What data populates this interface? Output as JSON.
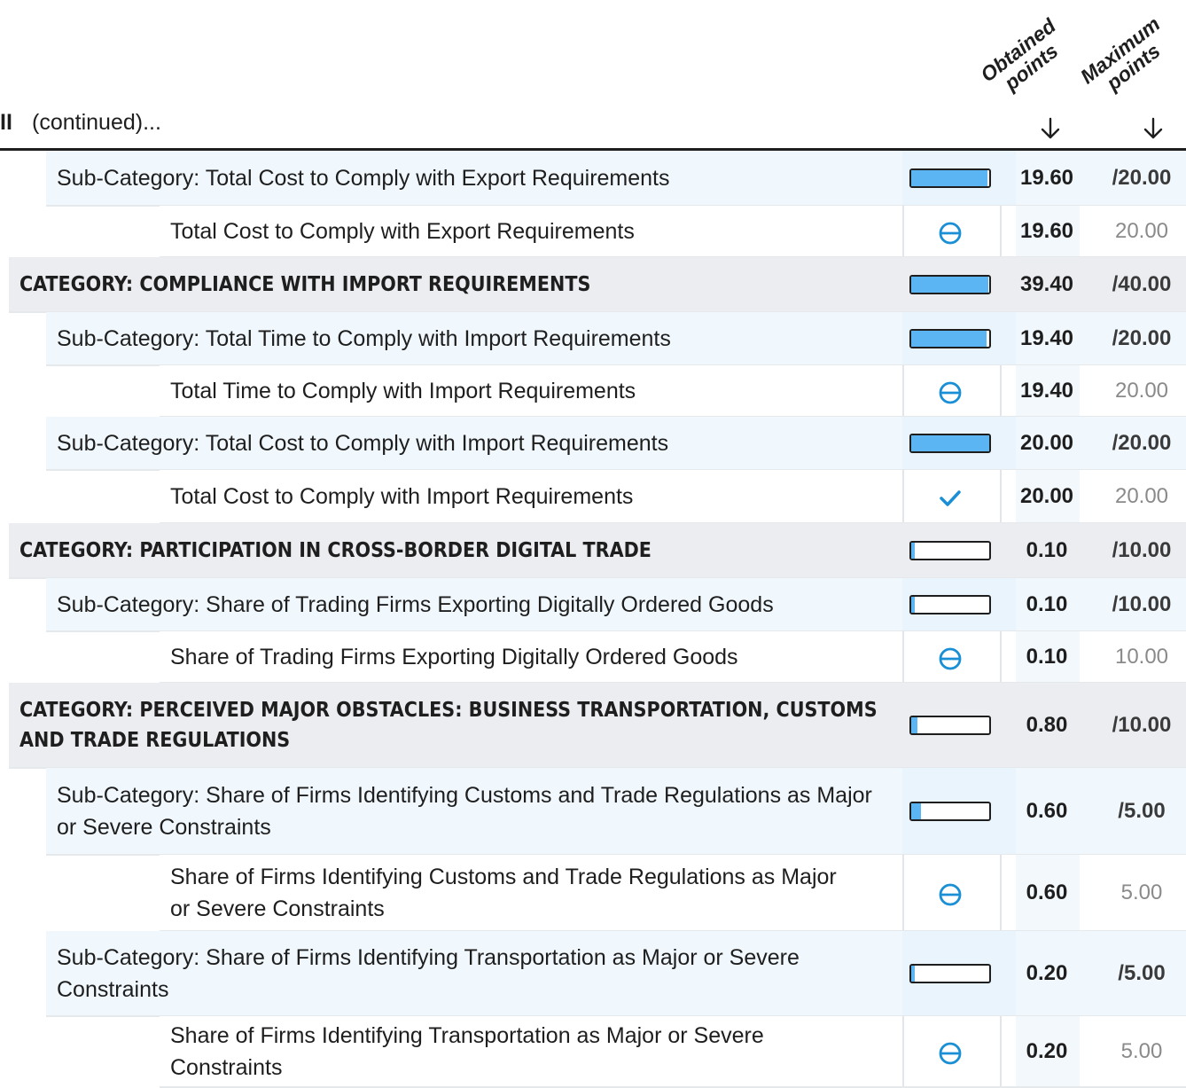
{
  "header": {
    "section_marker": "II",
    "continued": "(continued)...",
    "col_obtained_line1": "Obtained",
    "col_obtained_line2": "points",
    "col_maximum_line1": "Maximum",
    "col_maximum_line2": "points"
  },
  "colors": {
    "category_bg": "#ebedf1",
    "subcategory_bg": "#f1f8fd",
    "progress_fill": "#5ab5f2",
    "icon_blue": "#1a8fd6"
  },
  "rows": [
    {
      "kind": "sub",
      "label": "Sub-Category: Total Cost to Comply with Export Requirements",
      "score": "19.60",
      "max": "/20.00",
      "progress": 0.98
    },
    {
      "kind": "ind",
      "label": "Total Cost to Comply with Export Requirements",
      "score": "19.60",
      "max": "20.00",
      "icon": "partial-circle-icon"
    },
    {
      "kind": "cat",
      "label": "CATEGORY: COMPLIANCE WITH IMPORT REQUIREMENTS",
      "score": "39.40",
      "max": "/40.00",
      "progress": 0.985
    },
    {
      "kind": "sub",
      "label": "Sub-Category: Total Time to Comply with Import Requirements",
      "score": "19.40",
      "max": "/20.00",
      "progress": 0.97
    },
    {
      "kind": "ind",
      "label": "Total Time to Comply with Import Requirements",
      "score": "19.40",
      "max": "20.00",
      "icon": "partial-circle-icon"
    },
    {
      "kind": "sub",
      "label": "Sub-Category: Total Cost to Comply with Import Requirements",
      "score": "20.00",
      "max": "/20.00",
      "progress": 1.0
    },
    {
      "kind": "ind",
      "label": "Total Cost to Comply with Import Requirements",
      "score": "20.00",
      "max": "20.00",
      "icon": "check-icon"
    },
    {
      "kind": "cat",
      "label": "CATEGORY: PARTICIPATION IN CROSS-BORDER DIGITAL TRADE",
      "score": "0.10",
      "max": "/10.00",
      "progress": 0.01
    },
    {
      "kind": "sub",
      "label": "Sub-Category: Share of Trading Firms Exporting Digitally Ordered Goods",
      "score": "0.10",
      "max": "/10.00",
      "progress": 0.01
    },
    {
      "kind": "ind",
      "label": "Share of Trading Firms Exporting Digitally Ordered Goods",
      "score": "0.10",
      "max": "10.00",
      "icon": "partial-circle-icon"
    },
    {
      "kind": "cat",
      "label": "CATEGORY: PERCEIVED MAJOR OBSTACLES: BUSINESS TRANSPORTATION, CUSTOMS AND TRADE REGULATIONS",
      "score": "0.80",
      "max": "/10.00",
      "progress": 0.08
    },
    {
      "kind": "sub",
      "label": "Sub-Category: Share of Firms Identifying Customs and Trade Regulations as Major or Severe Constraints",
      "score": "0.60",
      "max": "/5.00",
      "progress": 0.12
    },
    {
      "kind": "ind",
      "label": "Share of Firms Identifying Customs and Trade Regulations as Major or Severe Constraints",
      "score": "0.60",
      "max": "5.00",
      "icon": "partial-circle-icon"
    },
    {
      "kind": "sub",
      "label": "Sub-Category: Share of Firms Identifying Transportation as Major or Severe Constraints",
      "score": "0.20",
      "max": "/5.00",
      "progress": 0.04
    },
    {
      "kind": "ind",
      "label": "Share of Firms Identifying Transportation as Major or Severe Constraints",
      "score": "0.20",
      "max": "5.00",
      "icon": "partial-circle-icon"
    }
  ]
}
